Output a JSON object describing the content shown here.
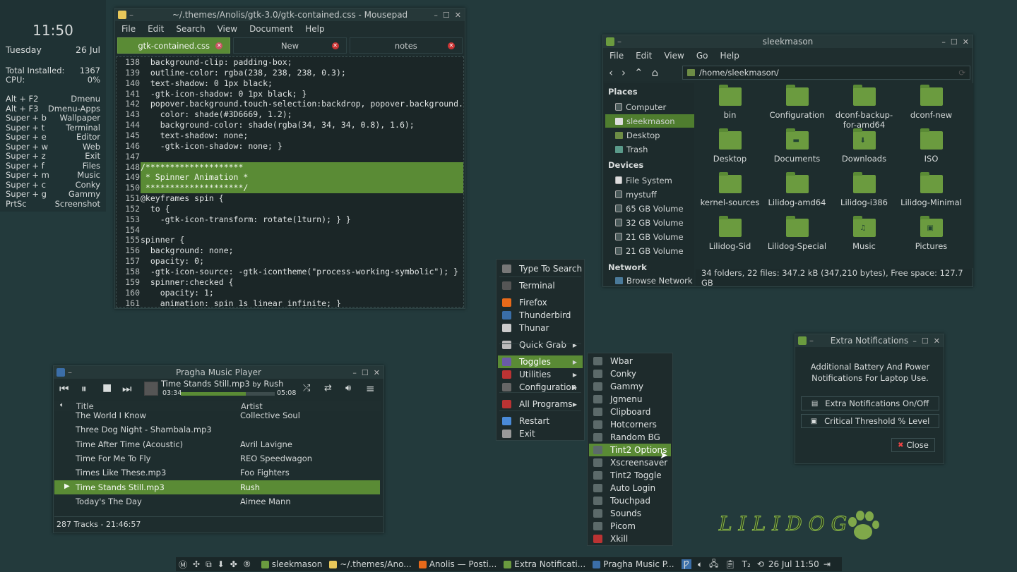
{
  "conky": {
    "time": "11:50",
    "day": "Tuesday",
    "date": "26 Jul",
    "installed_label": "Total Installed:",
    "installed_value": "1367",
    "cpu_label": "CPU:",
    "cpu_value": "0%",
    "shortcuts": [
      {
        "key": "Alt + F2",
        "action": "Dmenu"
      },
      {
        "key": "Alt + F3",
        "action": "Dmenu-Apps"
      },
      {
        "key": "Super + b",
        "action": "Wallpaper"
      },
      {
        "key": "Super + t",
        "action": "Terminal"
      },
      {
        "key": "Super + e",
        "action": "Editor"
      },
      {
        "key": "Super + w",
        "action": "Web"
      },
      {
        "key": "Super + z",
        "action": "Exit"
      },
      {
        "key": "Super + f",
        "action": "Files"
      },
      {
        "key": "Super + m",
        "action": "Music"
      },
      {
        "key": "Super + c",
        "action": "Conky"
      },
      {
        "key": "Super + g",
        "action": "Gammy"
      },
      {
        "key": "PrtSc",
        "action": "Screenshot"
      }
    ]
  },
  "mousepad": {
    "title": "~/.themes/Anolis/gtk-3.0/gtk-contained.css - Mousepad",
    "menu": [
      "File",
      "Edit",
      "Search",
      "View",
      "Document",
      "Help"
    ],
    "tabs": [
      {
        "label": "gtk-contained.css"
      },
      {
        "label": "New"
      },
      {
        "label": "notes"
      }
    ],
    "lines": [
      {
        "n": "138",
        "code": "  background-clip: padding-box;"
      },
      {
        "n": "139",
        "code": "  outline-color: rgba(238, 238, 238, 0.3);"
      },
      {
        "n": "140",
        "code": "  text-shadow: 0 1px black;"
      },
      {
        "n": "141",
        "code": "  -gtk-icon-shadow: 0 1px black; }"
      },
      {
        "n": "142",
        "code": "  popover.background.touch-selection:backdrop, popover.background.ma"
      },
      {
        "n": "143",
        "code": "    color: shade(#3D6669, 1.2);"
      },
      {
        "n": "144",
        "code": "    background-color: shade(rgba(34, 34, 34, 0.8), 1.6);"
      },
      {
        "n": "145",
        "code": "    text-shadow: none;"
      },
      {
        "n": "146",
        "code": "    -gtk-icon-shadow: none; }"
      },
      {
        "n": "147",
        "code": ""
      },
      {
        "n": "148",
        "code": "/********************"
      },
      {
        "n": "149",
        "code": " * Spinner Animation *"
      },
      {
        "n": "150",
        "code": " ********************/"
      },
      {
        "n": "151",
        "code": "@keyframes spin {"
      },
      {
        "n": "152",
        "code": "  to {"
      },
      {
        "n": "153",
        "code": "    -gtk-icon-transform: rotate(1turn); } }"
      },
      {
        "n": "154",
        "code": ""
      },
      {
        "n": "155",
        "code": "spinner {"
      },
      {
        "n": "156",
        "code": "  background: none;"
      },
      {
        "n": "157",
        "code": "  opacity: 0;"
      },
      {
        "n": "158",
        "code": "  -gtk-icon-source: -gtk-icontheme(\"process-working-symbolic\"); }"
      },
      {
        "n": "159",
        "code": "  spinner:checked {"
      },
      {
        "n": "160",
        "code": "    opacity: 1;"
      },
      {
        "n": "161",
        "code": "    animation: spin 1s linear infinite; }"
      }
    ]
  },
  "filemanager": {
    "title": "sleekmason",
    "menu": [
      "File",
      "Edit",
      "View",
      "Go",
      "Help"
    ],
    "path": "/home/sleekmason/",
    "places_header": "Places",
    "places": [
      "Computer",
      "sleekmason",
      "Desktop",
      "Trash"
    ],
    "devices_header": "Devices",
    "devices": [
      "File System",
      "mystuff",
      "65 GB Volume",
      "32 GB Volume",
      "21 GB Volume",
      "21 GB Volume"
    ],
    "network_header": "Network",
    "network": [
      "Browse Network"
    ],
    "files": [
      {
        "name": "bin"
      },
      {
        "name": "Configuration"
      },
      {
        "name": "dconf-backup-for-amd64"
      },
      {
        "name": "dconf-new"
      },
      {
        "name": "Desktop"
      },
      {
        "name": "Documents"
      },
      {
        "name": "Downloads"
      },
      {
        "name": "ISO"
      },
      {
        "name": "kernel-sources"
      },
      {
        "name": "Lilidog-amd64"
      },
      {
        "name": "Lilidog-i386"
      },
      {
        "name": "Lilidog-Minimal"
      },
      {
        "name": "Lilidog-Sid"
      },
      {
        "name": "Lilidog-Special"
      },
      {
        "name": "Music"
      },
      {
        "name": "Pictures"
      }
    ],
    "status": "34 folders, 22 files: 347.2 kB (347,210 bytes), Free space: 127.7 GB"
  },
  "pragha": {
    "title": "Pragha Music Player",
    "track": "Time Stands Still.mp3",
    "by": "by",
    "artist": "Rush",
    "elapsed": "03:34",
    "total": "05:08",
    "progress": 0.69,
    "col_title": "Title",
    "col_artist": "Artist",
    "rows": [
      {
        "title": "The World I Know",
        "artist": "Collective Soul"
      },
      {
        "title": "Three Dog Night - Shambala.mp3",
        "artist": ""
      },
      {
        "title": "Time After Time (Acoustic)",
        "artist": "Avril Lavigne"
      },
      {
        "title": "Time For Me To Fly",
        "artist": "REO Speedwagon"
      },
      {
        "title": "Times Like These.mp3",
        "artist": "Foo Fighters"
      },
      {
        "title": "Time Stands Still.mp3",
        "artist": "Rush"
      },
      {
        "title": "Today's The Day",
        "artist": "Aimee Mann"
      }
    ],
    "status": "287 Tracks - 21:46:57"
  },
  "rootmenu": {
    "items": [
      {
        "label": "Type To Search",
        "sub": false
      },
      {
        "label": "Terminal",
        "sub": false
      },
      {
        "label": "Firefox",
        "sub": false
      },
      {
        "label": "Thunderbird",
        "sub": false
      },
      {
        "label": "Thunar",
        "sub": false
      },
      {
        "label": "Quick Grab",
        "sub": true
      },
      {
        "label": "Toggles",
        "sub": true
      },
      {
        "label": "Utilities",
        "sub": true
      },
      {
        "label": "Configuration",
        "sub": true
      },
      {
        "label": "All Programs",
        "sub": true
      },
      {
        "label": "Restart",
        "sub": false
      },
      {
        "label": "Exit",
        "sub": false
      }
    ]
  },
  "togglesmenu": {
    "items": [
      "Wbar",
      "Conky",
      "Gammy",
      "Jgmenu",
      "Clipboard",
      "Hotcorners",
      "Random BG",
      "Tint2 Options",
      "Xscreensaver",
      "Tint2 Toggle",
      "Auto Login",
      "Touchpad",
      "Sounds",
      "Picom",
      "Xkill"
    ]
  },
  "notif": {
    "title": "Extra Notifications",
    "message": "Additional Battery And Power Notifications For Laptop Use.",
    "btn1": "Extra Notifications On/Off",
    "btn2": "Critical Threshold % Level",
    "close": "Close"
  },
  "taskbar": {
    "tasks": [
      {
        "label": "sleekmason"
      },
      {
        "label": "~/.themes/Ano..."
      },
      {
        "label": "Anolis — Posti..."
      },
      {
        "label": "Extra Notificati..."
      },
      {
        "label": "Pragha Music P..."
      }
    ],
    "clock": "26 Jul 11:50"
  },
  "logo": "LILIDOG",
  "colors": {
    "accent": "#5a8b35",
    "bg": "#233a3c"
  }
}
